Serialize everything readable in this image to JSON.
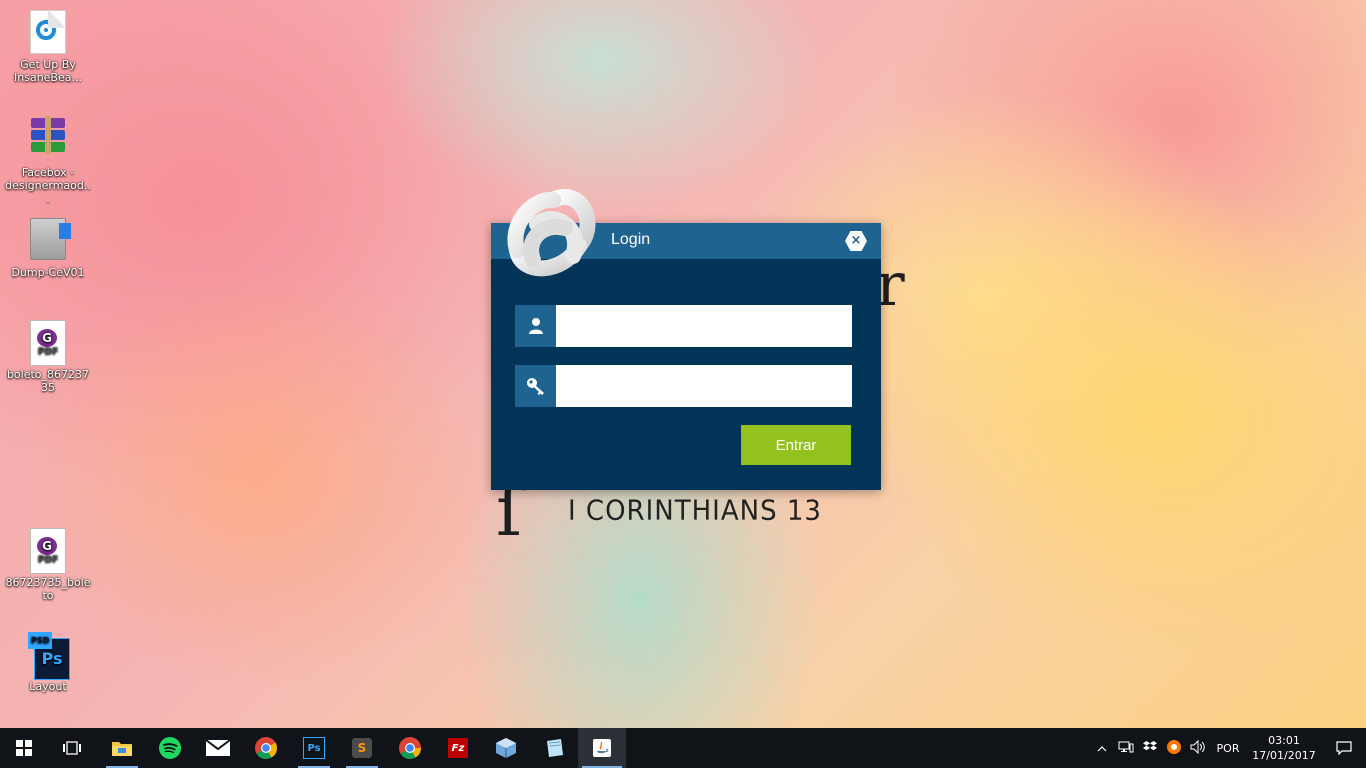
{
  "desktop": {
    "icons": [
      {
        "label": "Get Up By InsaneBea..."
      },
      {
        "label": "Facebox - designermaod..."
      },
      {
        "label": "Dump-CeV01"
      },
      {
        "label": "boleto_86723735"
      },
      {
        "label": "86723735_boleto"
      },
      {
        "label": "Layout",
        "badge": "PSD",
        "glyph": "Ps"
      }
    ],
    "pdf_glyph": "PDF"
  },
  "wallpaper": {
    "verse": "I CORINTHIANS 13"
  },
  "dialog": {
    "title": "Login",
    "close_label": "×",
    "username": {
      "value": "",
      "placeholder": ""
    },
    "password": {
      "value": "",
      "placeholder": ""
    },
    "submit_label": "Entrar",
    "colors": {
      "panel": "#023457",
      "titlebar": "#1f6490",
      "button": "#95c11f"
    }
  },
  "taskbar": {
    "apps": [
      {
        "icon": "file-explorer-icon"
      },
      {
        "icon": "spotify-icon"
      },
      {
        "icon": "mail-icon"
      },
      {
        "icon": "chrome-icon"
      },
      {
        "icon": "photoshop-icon",
        "glyph": "Ps"
      },
      {
        "icon": "sublime-text-icon",
        "glyph": "S"
      },
      {
        "icon": "chrome-icon"
      },
      {
        "icon": "filezilla-icon",
        "glyph": "Fz"
      },
      {
        "icon": "virtualbox-icon"
      },
      {
        "icon": "notepad-icon"
      },
      {
        "icon": "java-icon"
      }
    ],
    "tray": {
      "language": "POR",
      "time": "03:01",
      "date": "17/01/2017"
    }
  }
}
